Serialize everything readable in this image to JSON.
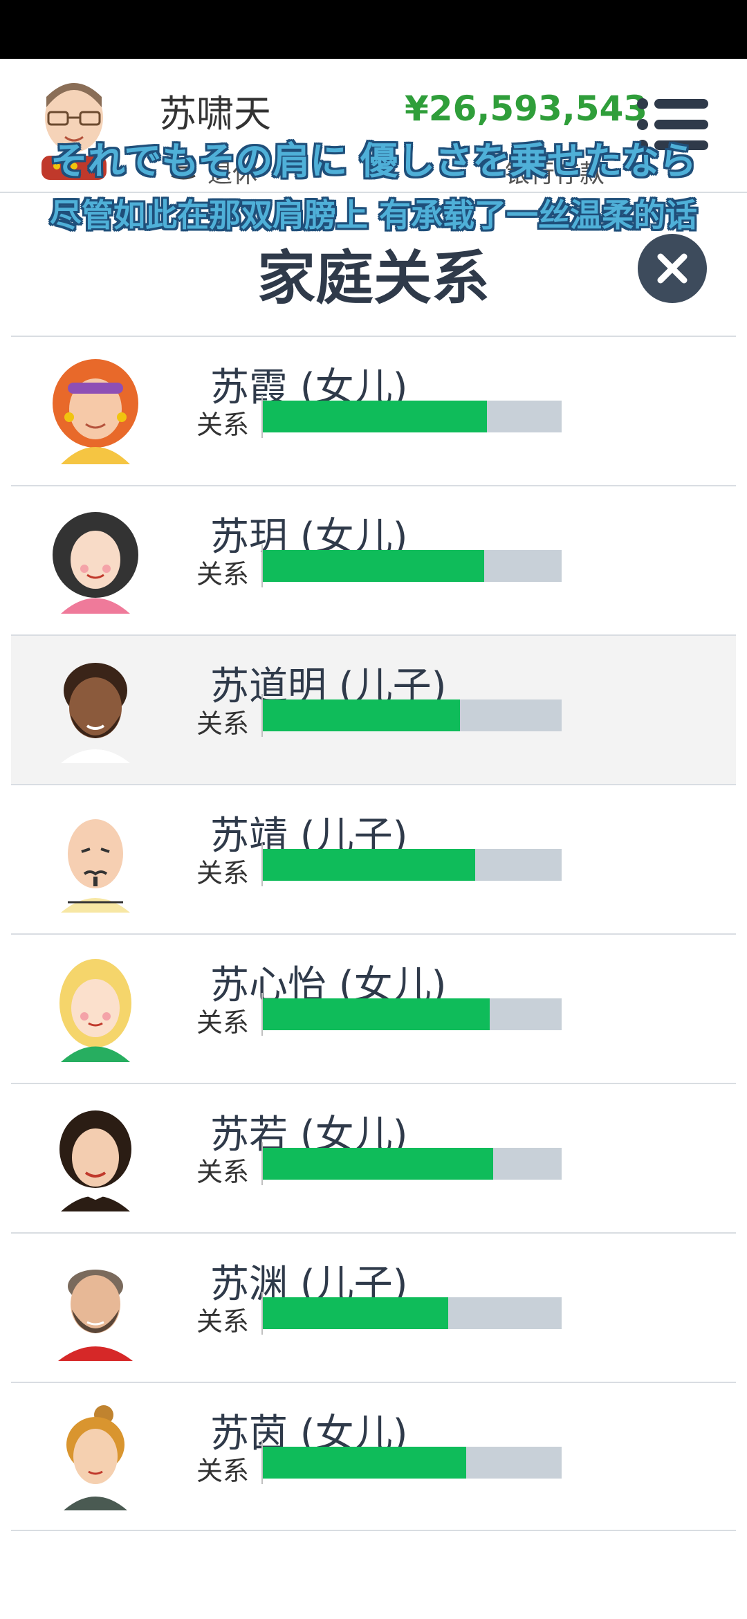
{
  "header": {
    "player_name": "苏啸天",
    "money": "¥26,593,543",
    "status": "退休",
    "money_label": "银行存款"
  },
  "subtitles": {
    "japanese": "それでもその肩に 優しさを乗せたなら",
    "chinese": "尽管如此在那双肩膀上 有承载了一丝温柔的话"
  },
  "title": "家庭关系",
  "colors": {
    "bar_fill": "#0fbc5a",
    "bar_track": "#c8d0d8",
    "money": "#2f9e3a",
    "close_button": "#3d4b5c"
  },
  "relation_label": "关系",
  "relatives": [
    {
      "name": "苏霞 (女儿)",
      "relationship": 0.75,
      "icon": "woman-headband-avatar-icon"
    },
    {
      "name": "苏玥 (女儿)",
      "relationship": 0.74,
      "icon": "woman-black-hair-avatar-icon"
    },
    {
      "name": "苏道明 (儿子)",
      "relationship": 0.66,
      "icon": "man-curly-beard-avatar-icon",
      "highlighted": true
    },
    {
      "name": "苏靖 (儿子)",
      "relationship": 0.71,
      "icon": "bald-man-avatar-icon"
    },
    {
      "name": "苏心怡 (女儿)",
      "relationship": 0.76,
      "icon": "blonde-woman-avatar-icon"
    },
    {
      "name": "苏若 (女儿)",
      "relationship": 0.77,
      "icon": "woman-dark-hair-avatar-icon"
    },
    {
      "name": "苏渊 (儿子)",
      "relationship": 0.62,
      "icon": "bearded-man-avatar-icon"
    },
    {
      "name": "苏茵 (女儿)",
      "relationship": 0.68,
      "icon": "girl-bun-avatar-icon"
    }
  ]
}
